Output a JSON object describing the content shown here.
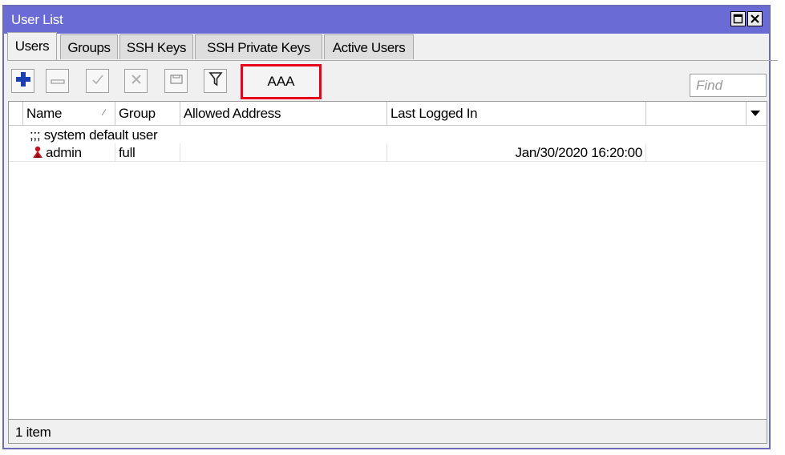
{
  "window": {
    "title": "User List",
    "maximize_icon": "maximize-icon",
    "close_icon": "close-icon",
    "title_bar_color": "#6b6bd6"
  },
  "tabs": [
    {
      "label": "Users",
      "active": true
    },
    {
      "label": "Groups",
      "active": false
    },
    {
      "label": "SSH Keys",
      "active": false
    },
    {
      "label": "SSH Private Keys",
      "active": false
    },
    {
      "label": "Active Users",
      "active": false
    }
  ],
  "toolbar": {
    "buttons": [
      {
        "name": "add",
        "icon": "plus-icon"
      },
      {
        "name": "remove",
        "icon": "minus-icon"
      },
      {
        "name": "enable",
        "icon": "check-icon"
      },
      {
        "name": "disable",
        "icon": "x-icon"
      },
      {
        "name": "comment",
        "icon": "comment-icon"
      },
      {
        "name": "filter",
        "icon": "filter-icon"
      }
    ],
    "aaa_label": "AAA",
    "highlight_color": "#e8001c",
    "find_placeholder": "Find"
  },
  "table": {
    "columns": [
      "Name",
      "Group",
      "Allowed Address",
      "Last Logged In",
      ""
    ],
    "comment_row": ";;; system default user",
    "rows": [
      {
        "icon": "user-icon",
        "name": "admin",
        "group": "full",
        "allowed_address": "",
        "last_logged_in": "Jan/30/2020 16:20:00"
      }
    ]
  },
  "status": {
    "item_count": "1 item"
  }
}
